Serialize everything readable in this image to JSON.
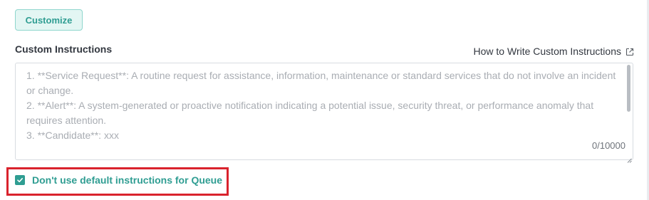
{
  "colors": {
    "accent": "#2f9d92",
    "accent_light_bg": "#e3f6f3",
    "highlight_red": "#d9232d",
    "placeholder_text": "#a9adb3"
  },
  "toolbar": {
    "customize_label": "Customize"
  },
  "instructions": {
    "section_label": "Custom Instructions",
    "help_link_label": "How to Write Custom Instructions",
    "help_link_icon": "external-link-icon",
    "placeholder": "1. **Service Request**: A routine request for assistance, information, maintenance or standard services that do not involve an incident or change.\n2. **Alert**: A system-generated or proactive notification indicating a potential issue, security threat, or performance anomaly that requires attention.\n3. **Candidate**: xxx",
    "value": "",
    "char_count": "0/10000"
  },
  "options": {
    "checkbox_label": "Don't use default instructions for Queue",
    "checkbox_checked": true,
    "checkbox_icon": "check-icon"
  }
}
